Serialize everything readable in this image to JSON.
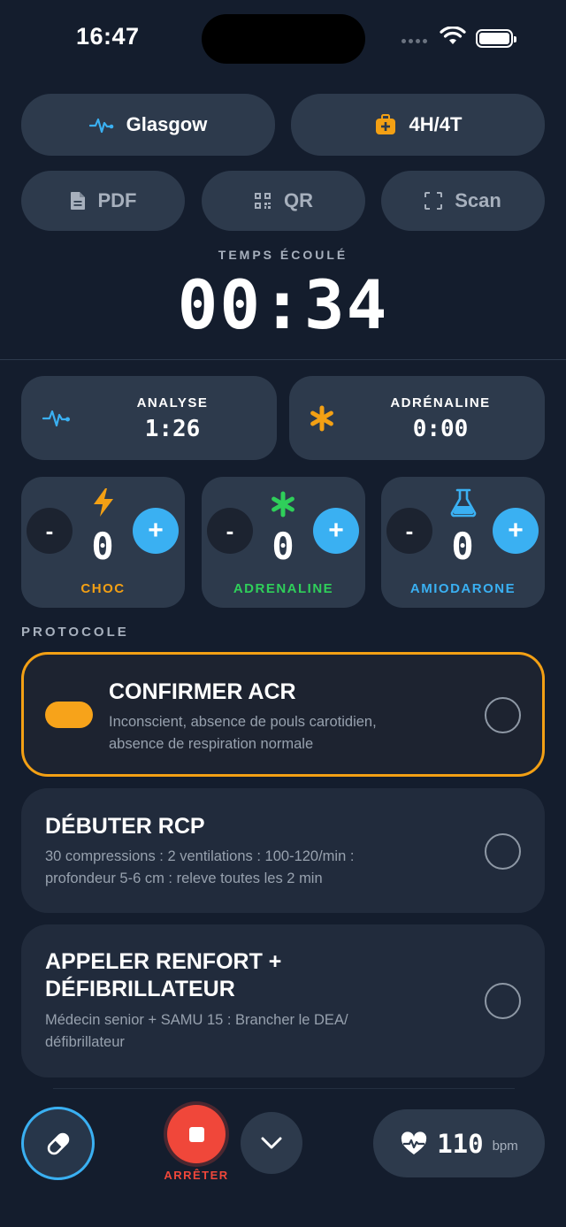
{
  "status_bar": {
    "time": "16:47"
  },
  "toolbar": {
    "glasgow_label": "Glasgow",
    "causes_label": "4H/4T",
    "pdf_label": "PDF",
    "qr_label": "QR",
    "scan_label": "Scan"
  },
  "elapsed": {
    "label": "TEMPS ÉCOULÉ",
    "value": "00:34"
  },
  "timers": {
    "analyse": {
      "label": "ANALYSE",
      "value": "1:26"
    },
    "adrenaline": {
      "label": "ADRÉNALINE",
      "value": "0:00"
    }
  },
  "counters": [
    {
      "label": "CHOC",
      "value": "0",
      "minus": "-",
      "plus": "+",
      "color": "#f3a014",
      "icon": "lightning-icon"
    },
    {
      "label": "ADRENALINE",
      "value": "0",
      "minus": "-",
      "plus": "+",
      "color": "#2fcf5a",
      "icon": "asterisk-icon"
    },
    {
      "label": "AMIODARONE",
      "value": "0",
      "minus": "-",
      "plus": "+",
      "color": "#3ab0f2",
      "icon": "flask-icon"
    }
  ],
  "protocol": {
    "section_label": "PROTOCOLE",
    "steps": [
      {
        "title": "CONFIRMER ACR",
        "desc_lines": [
          "Inconscient, absence de pouls carotidien,",
          "absence de respiration normale"
        ]
      },
      {
        "title": "DÉBUTER RCP",
        "desc_lines": [
          "30 compressions : 2 ventilations : 100-120/min :",
          "profondeur 5-6 cm : releve toutes les 2 min"
        ]
      },
      {
        "title_lines": [
          "APPELER RENFORT +",
          "DÉFIBRILLATEUR"
        ],
        "desc_lines": [
          "Médecin senior + SAMU 15 : Brancher le DEA/",
          "défibrillateur"
        ]
      }
    ]
  },
  "bottom": {
    "stop_label": "ARRÊTER",
    "bpm_value": "110",
    "bpm_unit": "bpm"
  },
  "colors": {
    "background": "#141d2d",
    "card": "#2d3a4c",
    "accent_orange": "#f3a014",
    "accent_green": "#2fcf5a",
    "accent_blue": "#3ab0f2",
    "stop_red": "#f0473a"
  }
}
